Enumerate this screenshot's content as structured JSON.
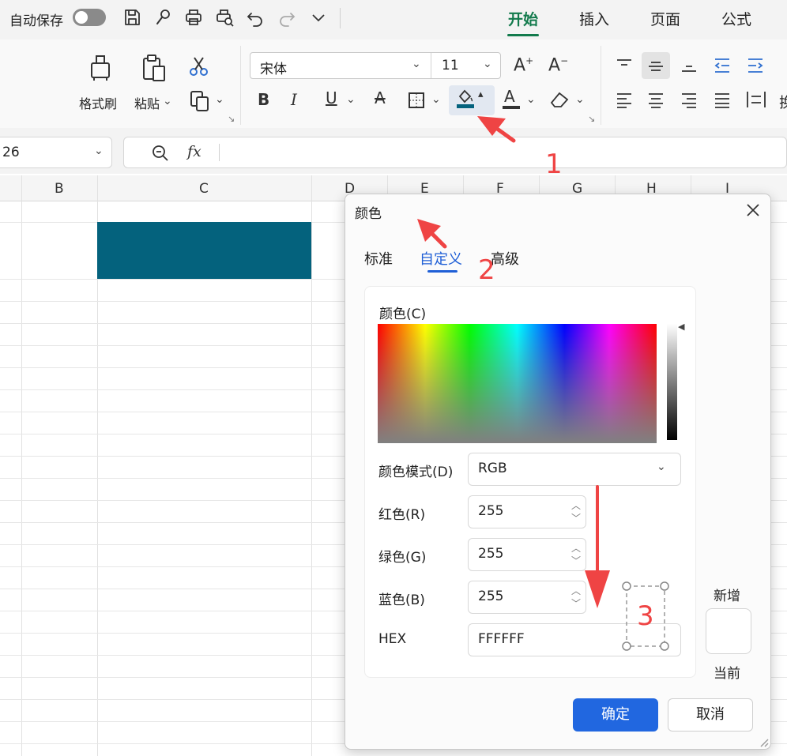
{
  "topbar": {
    "autosave_label": "自动保存",
    "autosave_on": false,
    "quick_icons": [
      "save-icon",
      "brush-icon",
      "print-icon",
      "print-preview-icon",
      "undo-icon",
      "redo-icon",
      "more-chevron-icon"
    ],
    "tabs": [
      "开始",
      "插入",
      "页面",
      "公式"
    ],
    "active_tab": "开始"
  },
  "ribbon": {
    "format_painter": "格式刷",
    "paste": "粘贴",
    "font_name": "宋体",
    "font_size": "11",
    "fill_color": "#04627d"
  },
  "formula_bar": {
    "name_box": "26",
    "fx_label": "fx",
    "formula": ""
  },
  "grid": {
    "columns": [
      "B",
      "C",
      "D",
      "E",
      "F",
      "G",
      "H",
      "I"
    ],
    "filled_cell_color": "#04627d"
  },
  "dialog": {
    "title": "颜色",
    "tabs": [
      "标准",
      "自定义",
      "高级"
    ],
    "active_tab": "自定义",
    "color_label": "颜色(C)",
    "mode_label": "颜色模式(D)",
    "mode_value": "RGB",
    "red_label": "红色(R)",
    "red_value": "255",
    "green_label": "绿色(G)",
    "green_value": "255",
    "blue_label": "蓝色(B)",
    "blue_value": "255",
    "hex_label": "HEX",
    "hex_value": "FFFFFF",
    "new_label": "新增",
    "current_label": "当前",
    "new_color": "#ffffff",
    "ok": "确定",
    "cancel": "取消"
  },
  "annotations": {
    "step1": "1",
    "step2": "2",
    "step3": "3",
    "color": "#ef4444"
  }
}
